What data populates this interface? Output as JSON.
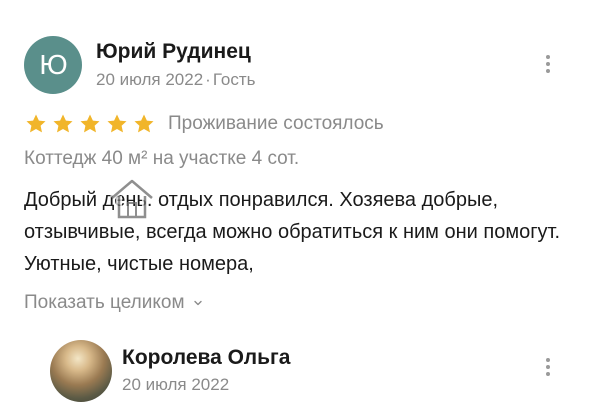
{
  "reviews": [
    {
      "avatar_initial": "Ю",
      "author": "Юрий Рудинец",
      "date": "20 июля 2022",
      "separator": "·",
      "guest_label": "Гость",
      "rating": 5,
      "stay_status": "Проживание состоялось",
      "room": "Коттедж 40 м² на участке 4 сот.",
      "text": "Добрый день. отдых понравился. Хозяева добрые, отзывчивые, всегда можно обратиться к ним они помогут. Уютные, чистые номера,",
      "expand_label": "Показать целиком"
    },
    {
      "author": "Королева Ольга",
      "date": "20 июля 2022"
    }
  ],
  "colors": {
    "avatar_bg": "#5a8f8b",
    "star": "#f1b52a",
    "muted_text": "#8a8a8a"
  },
  "icons": {
    "menu": "kebab-vertical-icon",
    "star": "star-icon",
    "expand": "chevron-down-icon",
    "watermark": "house-icon"
  }
}
